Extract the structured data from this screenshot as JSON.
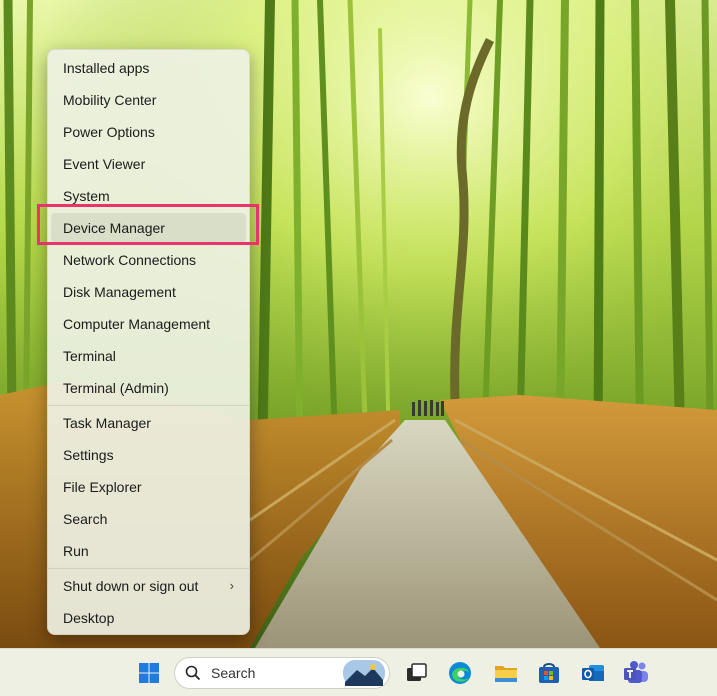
{
  "context_menu": {
    "items": [
      {
        "label": "Installed apps"
      },
      {
        "label": "Mobility Center"
      },
      {
        "label": "Power Options"
      },
      {
        "label": "Event Viewer"
      },
      {
        "label": "System"
      },
      {
        "label": "Device Manager",
        "highlighted": true
      },
      {
        "label": "Network Connections"
      },
      {
        "label": "Disk Management"
      },
      {
        "label": "Computer Management"
      },
      {
        "label": "Terminal"
      },
      {
        "label": "Terminal (Admin)"
      },
      {
        "label": "Task Manager"
      },
      {
        "label": "Settings"
      },
      {
        "label": "File Explorer"
      },
      {
        "label": "Search"
      },
      {
        "label": "Run"
      },
      {
        "label": "Shut down or sign out",
        "submenu_icon": "chevron-right-icon"
      },
      {
        "label": "Desktop"
      }
    ],
    "highlight_color": "#e8336b"
  },
  "taskbar": {
    "search_placeholder": "Search",
    "icons": [
      "windows-start-icon",
      "search-icon",
      "task-view-icon",
      "edge-icon",
      "file-explorer-icon",
      "microsoft-store-icon",
      "outlook-icon",
      "teams-icon"
    ]
  }
}
